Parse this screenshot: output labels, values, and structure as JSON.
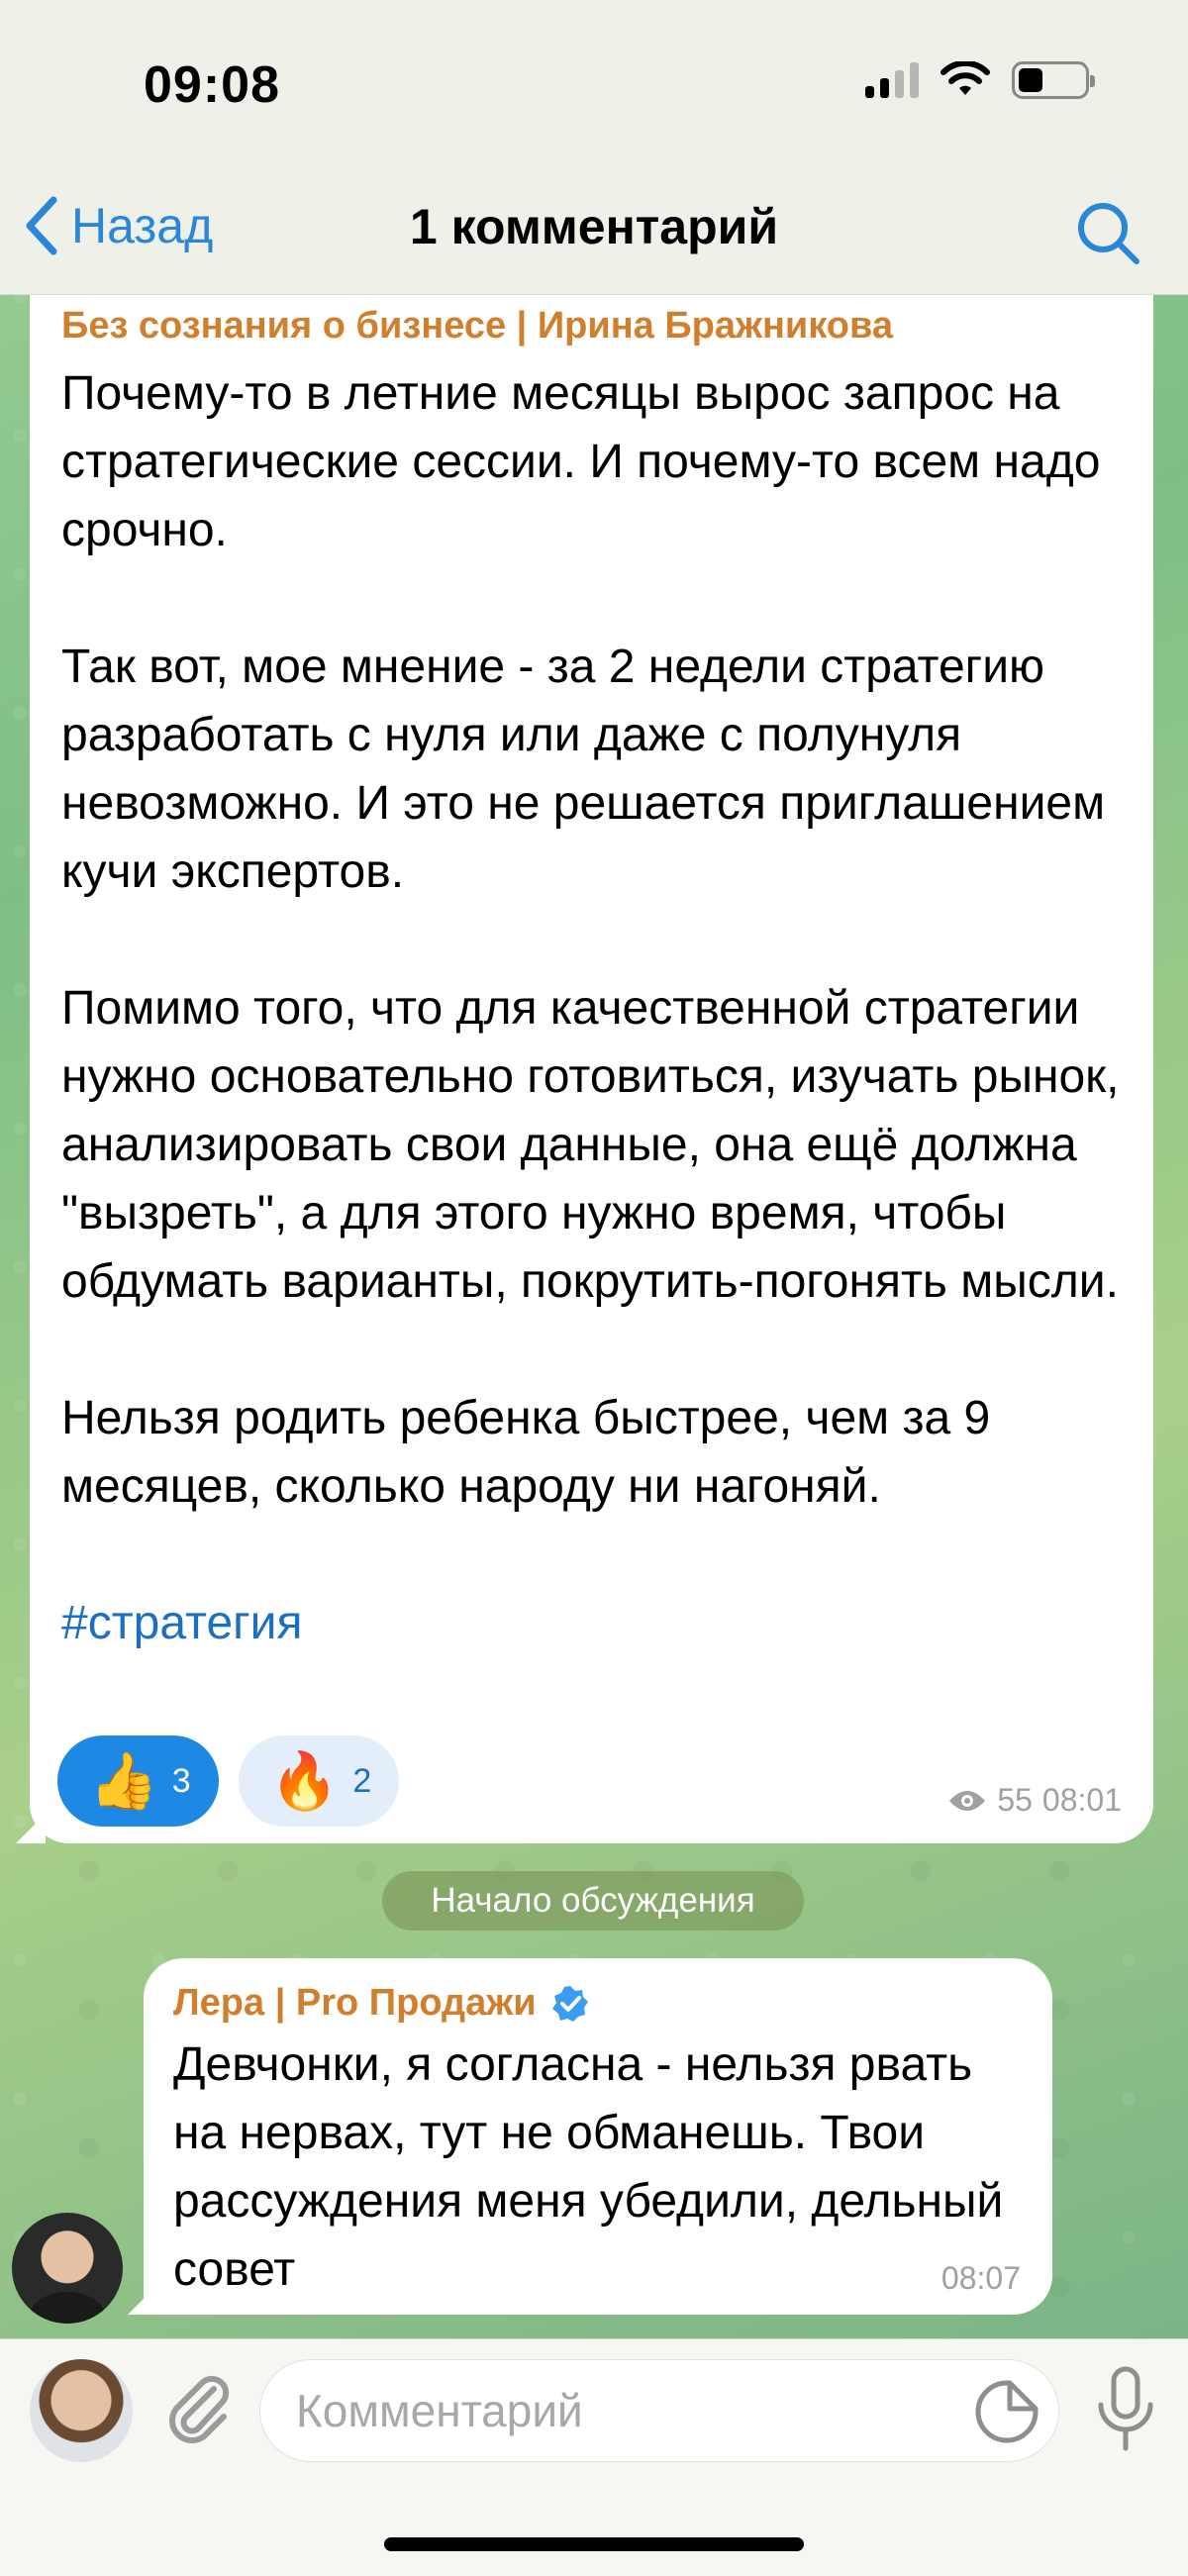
{
  "status_bar": {
    "time": "09:08"
  },
  "nav": {
    "back_label": "Назад",
    "title": "1 комментарий"
  },
  "post": {
    "channel": "Без сознания о бизнесе | Ирина Бражникова",
    "paragraphs": [
      "Почему-то в летние месяцы вырос запрос на стратегические сессии. И почему-то всем надо срочно.",
      "Так вот, мое мнение - за 2 недели стратегию разработать с нуля или даже с полунуля невозможно. И это не решается приглашением кучи экспертов.",
      "Помимо того, что для качественной стратегии нужно основательно готовиться, изучать рынок, анализировать свои данные, она ещё должна \"вызреть\", а для этого нужно время, чтобы обдумать варианты, покрутить-погонять мысли.",
      "Нельзя родить ребенка быстрее, чем за 9 месяцев, сколько народу ни нагоняй."
    ],
    "hashtag": "#стратегия",
    "reactions": [
      {
        "emoji": "👍",
        "count": "3"
      },
      {
        "emoji": "🔥",
        "count": "2"
      }
    ],
    "views": "55",
    "time": "08:01"
  },
  "discussion_label": "Начало обсуждения",
  "reply": {
    "author": "Лера | Pro Продажи",
    "text": "Девчонки, я согласна - нельзя рвать на нервах, тут не обманешь. Твои рассуждения меня убедили, дельный совет",
    "time": "08:07"
  },
  "composer": {
    "placeholder": "Комментарий"
  },
  "colors": {
    "accent": "#2a87d8",
    "author": "#d17f2d",
    "reaction_active": "#1e88e5"
  }
}
